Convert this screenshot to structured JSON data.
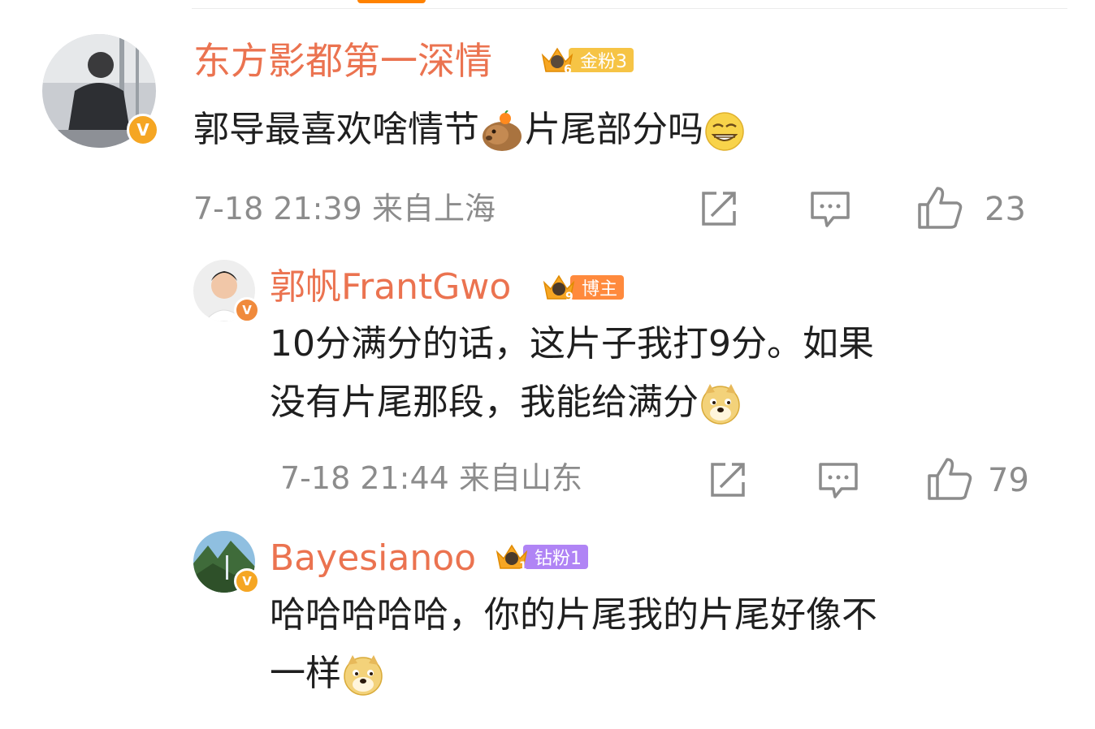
{
  "colors": {
    "username": "#eb7350",
    "meta_gray": "#8c8c8c",
    "verified_badge": "#f5a623",
    "gold_badge": "#f6c445",
    "blogger_badge": "#ff8a3d",
    "diamond_badge": "#b084f5"
  },
  "comments": [
    {
      "username": "东方影都第一深情",
      "badge_level": "6",
      "badge_label": "金粉3",
      "text": "郭导最喜欢啥情节",
      "text_after_emoji": "片尾部分吗",
      "emoji_1": "capybara-emoji",
      "emoji_2": "grin-emoji",
      "time": "7-18 21:39",
      "location": "来自上海",
      "likes": "23"
    },
    {
      "username": "郭帆FrantGwo",
      "badge_level": "9",
      "badge_label": "博主",
      "text_line1": "10分满分的话，这片子我打9分。如果",
      "text_line2": "没有片尾那段，我能给满分",
      "emoji": "doge-emoji",
      "time": "7-18 21:44",
      "location": "来自山东",
      "likes": "79"
    },
    {
      "username": "Bayesianoo",
      "badge_level": "1",
      "badge_label": "钻粉1",
      "text_line1": "哈哈哈哈哈，你的片尾我的片尾好像不",
      "text_line2": "一样",
      "emoji": "doge-emoji"
    }
  ]
}
